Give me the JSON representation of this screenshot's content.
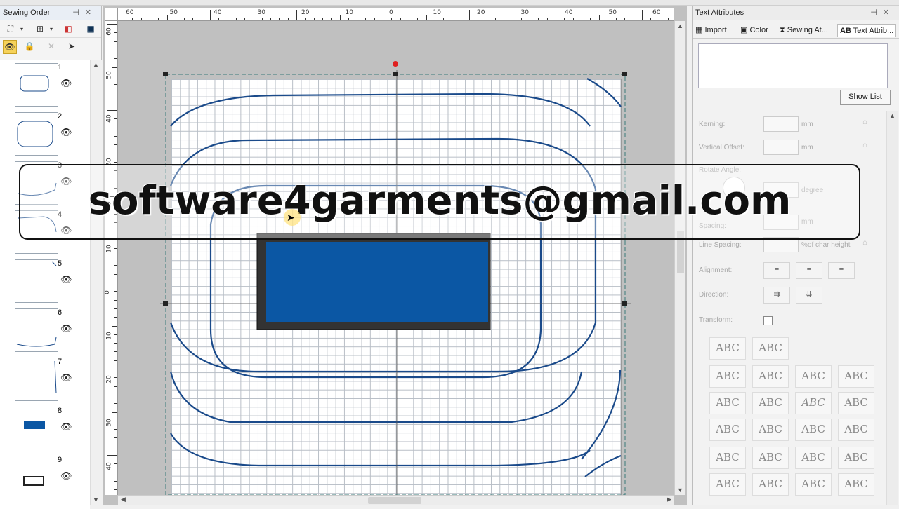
{
  "left_panel": {
    "title": "Sewing Order",
    "items": [
      {
        "num": "1"
      },
      {
        "num": "2"
      },
      {
        "num": "3"
      },
      {
        "num": "4"
      },
      {
        "num": "5"
      },
      {
        "num": "6"
      },
      {
        "num": "7"
      },
      {
        "num": "8"
      },
      {
        "num": "9"
      }
    ]
  },
  "ruler": {
    "top": [
      "60",
      "50",
      "40",
      "30",
      "20",
      "10",
      "0",
      "10",
      "20",
      "30",
      "40",
      "50",
      "60"
    ],
    "left": [
      "60",
      "50",
      "40",
      "30",
      "20",
      "10",
      "0",
      "10",
      "20",
      "30",
      "40"
    ]
  },
  "right_panel": {
    "title": "Text Attributes",
    "tabs": [
      "Import",
      "Color",
      "Sewing At...",
      "Text Attrib..."
    ],
    "show_list": "Show List",
    "kerning_label": "Kerning:",
    "kerning_unit": "mm",
    "vertical_offset_label": "Vertical Offset:",
    "vertical_offset_unit": "mm",
    "rotate_label": "Rotate Angle:",
    "rotate_unit": "degree",
    "spacing_label": "Spacing:",
    "spacing_unit": "mm",
    "line_spacing_label": "Line Spacing:",
    "line_spacing_unit": "%of char height",
    "alignment_label": "Alignment:",
    "direction_label": "Direction:",
    "transform_label": "Transform:",
    "shape_sample": "ABC"
  },
  "watermark": "software4garments@gmail.com",
  "colors": {
    "design_blue": "#0b57a4",
    "outline_dark": "#333333",
    "hoop_line": "#1a4a8a"
  }
}
